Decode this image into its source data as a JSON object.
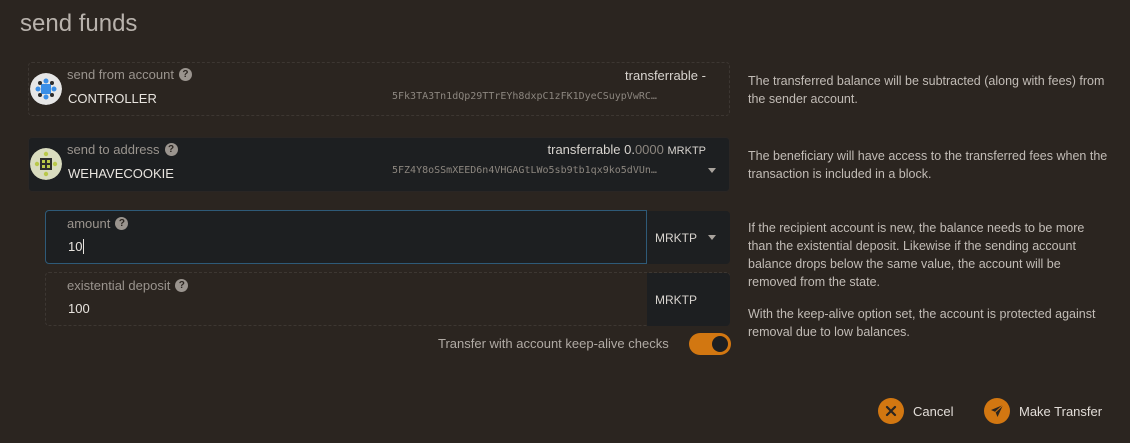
{
  "title": "send funds",
  "from": {
    "label": "send from account",
    "name": "CONTROLLER",
    "address": "5Fk3TA3Tn1dQp29TTrEYh8dxpC1zFK1DyeCSuypVwRC…",
    "transferable_label": "transferrable",
    "transferable_value": "-",
    "help": "The transferred balance will be subtracted (along with fees) from the sender account."
  },
  "to": {
    "label": "send to address",
    "name": "WEHAVECOOKIE",
    "address": "5FZ4Y8oSSmXEED6n4VHGAGtLWo5sb9tb1qx9ko5dVUn…",
    "transferable_label": "transferrable",
    "transferable_int": "0.",
    "transferable_dec": "0000",
    "transferable_unit": "MRKTP",
    "help": "The beneficiary will have access to the transferred fees when the transaction is included in a block."
  },
  "amount": {
    "label": "amount",
    "value": "10",
    "unit": "MRKTP"
  },
  "deposit": {
    "label": "existential deposit",
    "value": "100",
    "unit": "MRKTP"
  },
  "amount_help_1": "If the recipient account is new, the balance needs to be more than the existential deposit. Likewise if the sending account balance drops below the same value, the account will be removed from the state.",
  "amount_help_2": "With the keep-alive option set, the account is protected against removal due to low balances.",
  "keepalive": {
    "label": "Transfer with account keep-alive checks",
    "enabled": true
  },
  "buttons": {
    "cancel": "Cancel",
    "submit": "Make Transfer"
  },
  "colors": {
    "accent": "#d27711",
    "background": "#2b2520",
    "field": "#1d1f21"
  }
}
